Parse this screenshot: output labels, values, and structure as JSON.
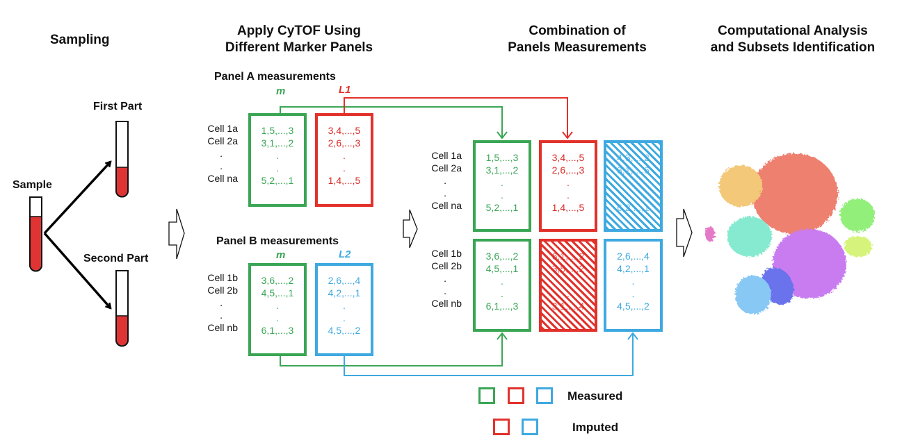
{
  "headers": {
    "sampling": "Sampling",
    "apply_line1": "Apply CyTOF Using",
    "apply_line2": "Different Marker Panels",
    "combination_line1": "Combination of",
    "combination_line2": "Panels Measurements",
    "analysis_line1": "Computational Analysis",
    "analysis_line2": "and Subsets Identification"
  },
  "sampling": {
    "sample_label": "Sample",
    "first_part_label": "First Part",
    "second_part_label": "Second Part"
  },
  "panel_a": {
    "title": "Panel A measurements",
    "col_m": "m",
    "col_l": "L1",
    "cells": [
      "Cell 1a",
      "Cell 2a",
      ".",
      ".",
      "Cell na"
    ],
    "m_values": [
      "1,5,...,3",
      "3,1,...,2",
      ".",
      ".",
      "5,2,...,1"
    ],
    "l_values": [
      "3,4,...,5",
      "2,6,...,3",
      ".",
      ".",
      "1,4,...,5"
    ]
  },
  "panel_b": {
    "title": "Panel B measurements",
    "col_m": "m",
    "col_l": "L2",
    "cells": [
      "Cell 1b",
      "Cell 2b",
      ".",
      ".",
      "Cell nb"
    ],
    "m_values": [
      "3,6,...,2",
      "4,5,...,1",
      ".",
      ".",
      "6,1,...,3"
    ],
    "l_values": [
      "2,6,...,4",
      "4,2,...,1",
      ".",
      ".",
      "4,5,...,2"
    ]
  },
  "combined": {
    "top": {
      "cells": [
        "Cell 1a",
        "Cell 2a",
        ".",
        ".",
        "Cell na"
      ],
      "m_values": [
        "1,5,...,3",
        "3,1,...,2",
        ".",
        ".",
        "5,2,...,1"
      ],
      "l1_values": [
        "3,4,...,5",
        "2,6,...,3",
        ".",
        ".",
        "1,4,...,5"
      ],
      "l2_imputed_values": [
        "4,3,...,2",
        "3,1,...,6",
        ".",
        ".",
        "6,2,...,1"
      ]
    },
    "bottom": {
      "cells": [
        "Cell 1b",
        "Cell 2b",
        ".",
        ".",
        "Cell nb"
      ],
      "m_values": [
        "3,6,...,2",
        "4,5,...,1",
        ".",
        ".",
        "6,1,...,3"
      ],
      "l1_imputed_values": [
        "6,1,...,2",
        "3,5,...,2",
        ".",
        ".",
        "3,1,...,4"
      ],
      "l2_values": [
        "2,6,...,4",
        "4,2,...,1",
        ".",
        ".",
        "4,5,...,2"
      ]
    }
  },
  "legend": {
    "measured": "Measured",
    "imputed": "Imputed"
  },
  "colors": {
    "m": "#3aa655",
    "l1": "#e2312b",
    "l2": "#3ea9e0",
    "blood": "#e03434"
  },
  "clusters": [
    {
      "name": "salmon",
      "color": "#ee8070"
    },
    {
      "name": "orange",
      "color": "#f3c878"
    },
    {
      "name": "mint",
      "color": "#86ead0"
    },
    {
      "name": "magenta",
      "color": "#e678c8"
    },
    {
      "name": "green",
      "color": "#92f07a"
    },
    {
      "name": "lime",
      "color": "#d6f47c"
    },
    {
      "name": "violet",
      "color": "#c97cf0"
    },
    {
      "name": "indigo",
      "color": "#6a72ec"
    },
    {
      "name": "sky",
      "color": "#88c8f4"
    }
  ]
}
